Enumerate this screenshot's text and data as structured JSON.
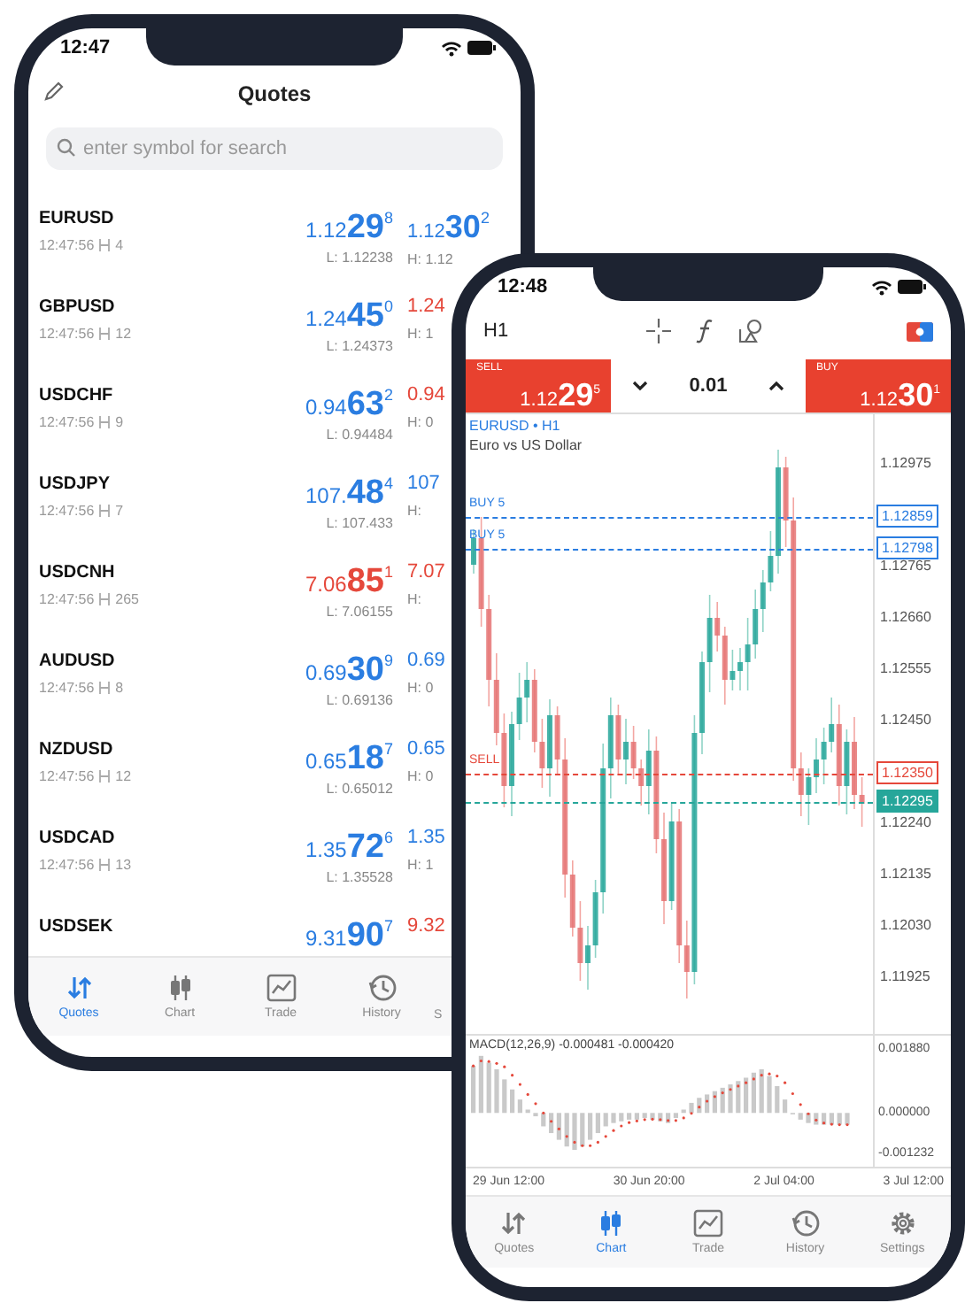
{
  "quotes_phone": {
    "status_time": "12:47",
    "title": "Quotes",
    "search": {
      "placeholder": "enter symbol for search"
    },
    "quotes": [
      {
        "symbol": "EURUSD",
        "time": "12:47:56",
        "spread": "4",
        "bid": {
          "head": "1.12",
          "big": "29",
          "sup": "8"
        },
        "bid_up": true,
        "low": "L: 1.12238",
        "ask": {
          "head": "1.12",
          "big": "30",
          "sup": "2"
        },
        "ask_up": true,
        "high": "H: 1.12"
      },
      {
        "symbol": "GBPUSD",
        "time": "12:47:56",
        "spread": "12",
        "bid": {
          "head": "1.24",
          "big": "45",
          "sup": "0"
        },
        "bid_up": true,
        "low": "L: 1.24373",
        "ask": {
          "head": "1.24"
        },
        "ask_up": false,
        "high": "H: 1"
      },
      {
        "symbol": "USDCHF",
        "time": "12:47:56",
        "spread": "9",
        "bid": {
          "head": "0.94",
          "big": "63",
          "sup": "2"
        },
        "bid_up": true,
        "low": "L: 0.94484",
        "ask": {
          "head": "0.94"
        },
        "ask_up": false,
        "high": "H: 0"
      },
      {
        "symbol": "USDJPY",
        "time": "12:47:56",
        "spread": "7",
        "bid": {
          "head": "107.",
          "big": "48",
          "sup": "4"
        },
        "bid_up": true,
        "low": "L: 107.433",
        "ask": {
          "head": "107"
        },
        "ask_up": true,
        "high": "H:"
      },
      {
        "symbol": "USDCNH",
        "time": "12:47:56",
        "spread": "265",
        "bid": {
          "head": "7.06",
          "big": "85",
          "sup": "1"
        },
        "bid_up": false,
        "low": "L: 7.06155",
        "ask": {
          "head": "7.07"
        },
        "ask_up": false,
        "high": "H:"
      },
      {
        "symbol": "AUDUSD",
        "time": "12:47:56",
        "spread": "8",
        "bid": {
          "head": "0.69",
          "big": "30",
          "sup": "9"
        },
        "bid_up": true,
        "low": "L: 0.69136",
        "ask": {
          "head": "0.69"
        },
        "ask_up": true,
        "high": "H: 0"
      },
      {
        "symbol": "NZDUSD",
        "time": "12:47:56",
        "spread": "12",
        "bid": {
          "head": "0.65",
          "big": "18",
          "sup": "7"
        },
        "bid_up": true,
        "low": "L: 0.65012",
        "ask": {
          "head": "0.65"
        },
        "ask_up": true,
        "high": "H: 0"
      },
      {
        "symbol": "USDCAD",
        "time": "12:47:56",
        "spread": "13",
        "bid": {
          "head": "1.35",
          "big": "72",
          "sup": "6"
        },
        "bid_up": true,
        "low": "L: 1.35528",
        "ask": {
          "head": "1.35"
        },
        "ask_up": true,
        "high": "H: 1"
      },
      {
        "symbol": "USDSEK",
        "bid": {
          "head": "9.31",
          "big": "90",
          "sup": "7"
        },
        "bid_up": true,
        "ask": {
          "head": "9.32"
        },
        "ask_up": false
      }
    ],
    "tabs": [
      {
        "kind": "quotes",
        "label": "Quotes",
        "selected": true
      },
      {
        "kind": "chart",
        "label": "Chart",
        "selected": false
      },
      {
        "kind": "trade",
        "label": "Trade",
        "selected": false
      },
      {
        "kind": "history",
        "label": "History",
        "selected": false
      },
      {
        "label": "S",
        "selected": false
      }
    ]
  },
  "chart_phone": {
    "status_time": "12:48",
    "timeframe": "H1",
    "trade_bar": {
      "sell": {
        "label": "SELL",
        "head": "1.12",
        "big": "29",
        "sup": "5"
      },
      "volume": "0.01",
      "buy": {
        "label": "BUY",
        "head": "1.12",
        "big": "30",
        "sup": "1"
      }
    },
    "symbol": "EURUSD • H1",
    "description": "Euro vs US Dollar",
    "price_axis": [
      "1.12975",
      "1.12765",
      "1.12660",
      "1.12555",
      "1.12450",
      "1.12240",
      "1.12135",
      "1.12030",
      "1.11925"
    ],
    "order_lines": [
      {
        "kind": "buy",
        "label": "BUY 5",
        "price": "1.12859"
      },
      {
        "kind": "buy",
        "label": "BUY 5",
        "price": "1.12798"
      },
      {
        "kind": "sell",
        "label": "SELL",
        "price": "1.12350"
      },
      {
        "kind": "bid",
        "price": "1.12295"
      }
    ],
    "macd": {
      "title": "MACD(12,26,9) -0.000481 -0.000420",
      "axis": [
        "0.001880",
        "0.000000",
        "-0.001232"
      ]
    },
    "time_axis": [
      "29 Jun 12:00",
      "30 Jun 20:00",
      "2 Jul 04:00",
      "3 Jul 12:00"
    ],
    "tabs": [
      {
        "kind": "quotes",
        "label": "Quotes",
        "selected": false
      },
      {
        "kind": "chart",
        "label": "Chart",
        "selected": true
      },
      {
        "kind": "trade",
        "label": "Trade",
        "selected": false
      },
      {
        "kind": "history",
        "label": "History",
        "selected": false
      },
      {
        "kind": "settings",
        "label": "Settings",
        "selected": false
      }
    ]
  }
}
